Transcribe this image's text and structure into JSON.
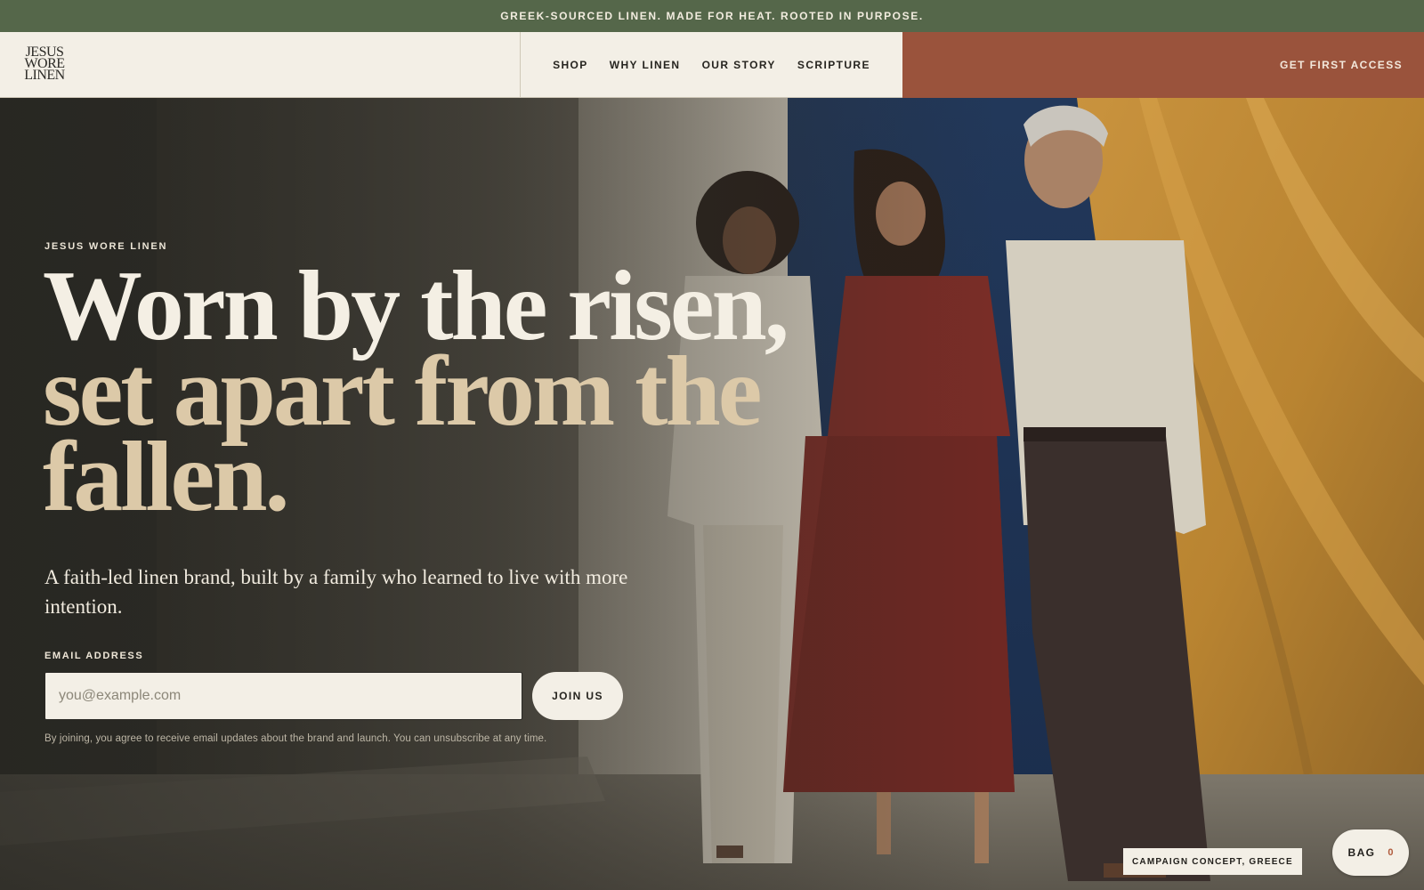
{
  "announcement": {
    "text": "GREEK-SOURCED LINEN. MADE FOR HEAT. ROOTED IN PURPOSE."
  },
  "header": {
    "logo_lines": [
      "JESUS",
      "WORE",
      "LINEN"
    ],
    "nav": [
      {
        "label": "SHOP"
      },
      {
        "label": "WHY LINEN"
      },
      {
        "label": "OUR STORY"
      },
      {
        "label": "SCRIPTURE"
      }
    ],
    "cta_label": "GET FIRST ACCESS"
  },
  "hero": {
    "eyebrow": "JESUS WORE LINEN",
    "headline_line1": "Worn by the risen,",
    "headline_line2": "set apart from the",
    "headline_line3": "fallen.",
    "subheadline": "A faith-led linen brand, built by a family who learned to live with more intention.",
    "email_label": "EMAIL ADDRESS",
    "email_placeholder": "you@example.com",
    "join_label": "JOIN US",
    "disclaimer": "By joining, you agree to receive email updates about the brand and launch. You can unsubscribe at any time.",
    "photo_caption": "CAMPAIGN CONCEPT, GREECE"
  },
  "bag": {
    "label": "BAG",
    "count": "0"
  },
  "colors": {
    "announcement_bg": "#55674a",
    "cta_bg": "#9a533c",
    "cream": "#f3efe6",
    "headline_accent": "#dcc9a8"
  }
}
